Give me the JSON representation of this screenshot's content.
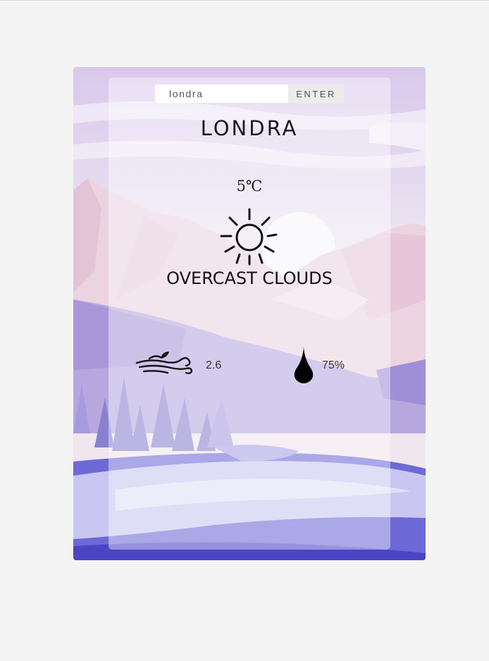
{
  "search": {
    "value": "londra",
    "button_label": "ENTER"
  },
  "weather": {
    "city": "LONDRA",
    "temperature": "5℃",
    "description": "OVERCAST CLOUDS",
    "wind": "2.6",
    "humidity": "75%"
  },
  "icons": {
    "weather": "sun-icon",
    "wind": "wind-icon",
    "humidity": "water-drop-icon"
  },
  "colors": {
    "page_background": "#f4f4f4",
    "text": "#1a1a1a",
    "panel": "rgba(255,255,255,0.42)"
  }
}
